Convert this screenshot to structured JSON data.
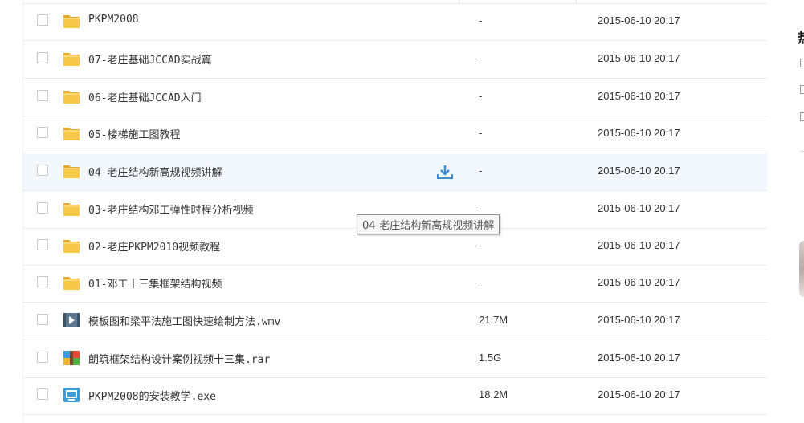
{
  "files": [
    {
      "name": "PKPM2008",
      "type": "folder",
      "size": "-",
      "date": "2015-06-10 20:17"
    },
    {
      "name": "07-老庄基础JCCAD实战篇",
      "type": "folder",
      "size": "-",
      "date": "2015-06-10 20:17"
    },
    {
      "name": "06-老庄基础JCCAD入门",
      "type": "folder",
      "size": "-",
      "date": "2015-06-10 20:17"
    },
    {
      "name": "05-楼梯施工图教程",
      "type": "folder",
      "size": "-",
      "date": "2015-06-10 20:17"
    },
    {
      "name": "04-老庄结构新高规视频讲解",
      "type": "folder",
      "size": "-",
      "date": "2015-06-10 20:17"
    },
    {
      "name": "03-老庄结构邓工弹性时程分析视频",
      "type": "folder",
      "size": "-",
      "date": "2015-06-10 20:17"
    },
    {
      "name": "02-老庄PKPM2010视频教程",
      "type": "folder",
      "size": "-",
      "date": "2015-06-10 20:17"
    },
    {
      "name": "01-邓工十三集框架结构视频",
      "type": "folder",
      "size": "-",
      "date": "2015-06-10 20:17"
    },
    {
      "name": "模板图和梁平法施工图快速绘制方法.wmv",
      "type": "video",
      "size": "21.7M",
      "date": "2015-06-10 20:17"
    },
    {
      "name": "朗筑框架结构设计案例视频十三集.rar",
      "type": "archive",
      "size": "1.5G",
      "date": "2015-06-10 20:17"
    },
    {
      "name": "PKPM2008的安装教学.exe",
      "type": "exe",
      "size": "18.2M",
      "date": "2015-06-10 20:17"
    }
  ],
  "hovered_row": 4,
  "tooltip": "04-老庄结构新高规视频讲解",
  "sidebar": {
    "char": "热"
  },
  "colors": {
    "folder": "#f5c342",
    "hover_bg": "#f2f8fe",
    "download_icon": "#3b8fd9"
  }
}
